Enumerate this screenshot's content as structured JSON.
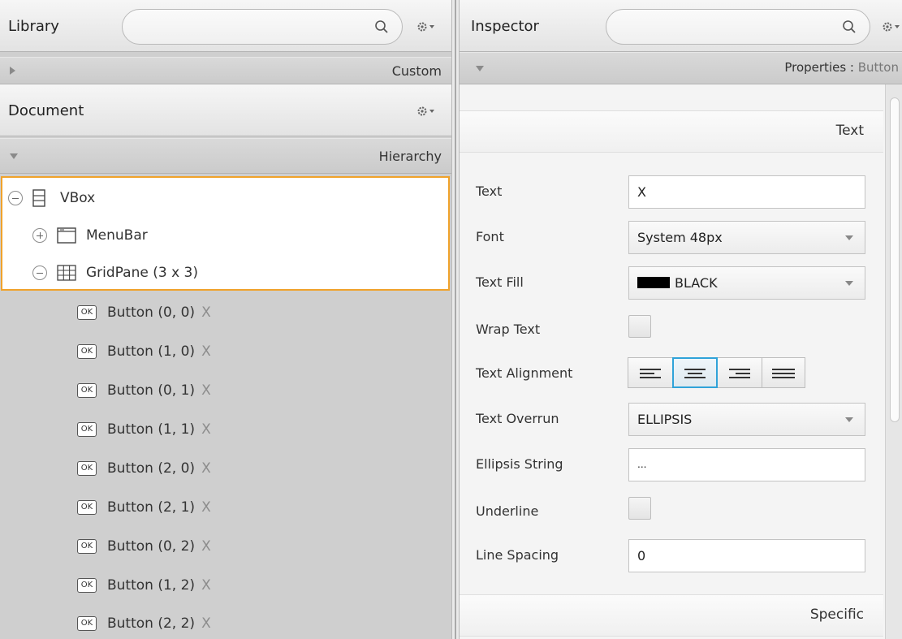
{
  "library": {
    "title": "Library",
    "custom_label": "Custom"
  },
  "document": {
    "title": "Document",
    "hierarchy_label": "Hierarchy",
    "tree": [
      {
        "label": "VBox",
        "expander": "collapse"
      },
      {
        "label": "MenuBar",
        "expander": "expand"
      },
      {
        "label": "GridPane (3 x 3)",
        "expander": "collapse"
      }
    ],
    "buttons": [
      {
        "label": "Button (0, 0)",
        "text": "X"
      },
      {
        "label": "Button (1, 0)",
        "text": "X"
      },
      {
        "label": "Button (0, 1)",
        "text": "X"
      },
      {
        "label": "Button (1, 1)",
        "text": "X"
      },
      {
        "label": "Button (2, 0)",
        "text": "X"
      },
      {
        "label": "Button (2, 1)",
        "text": "X"
      },
      {
        "label": "Button (0, 2)",
        "text": "X"
      },
      {
        "label": "Button (1, 2)",
        "text": "X"
      },
      {
        "label": "Button (2, 2)",
        "text": "X"
      }
    ],
    "button_icon_text": "OK"
  },
  "inspector": {
    "title": "Inspector",
    "properties_prefix": "Properties : ",
    "properties_target": "Button",
    "section_text": "Text",
    "section_specific": "Specific",
    "fields": {
      "text": {
        "label": "Text",
        "value": "X"
      },
      "font": {
        "label": "Font",
        "value": "System 48px"
      },
      "text_fill": {
        "label": "Text Fill",
        "value": "BLACK",
        "color": "#000000"
      },
      "wrap_text": {
        "label": "Wrap Text"
      },
      "text_alignment": {
        "label": "Text Alignment",
        "options": [
          "left",
          "center",
          "right",
          "justify"
        ],
        "selected": "center"
      },
      "text_overrun": {
        "label": "Text Overrun",
        "value": "ELLIPSIS"
      },
      "ellipsis_string": {
        "label": "Ellipsis String",
        "value": "..."
      },
      "underline": {
        "label": "Underline"
      },
      "line_spacing": {
        "label": "Line Spacing",
        "value": "0"
      }
    }
  },
  "colors": {
    "selection_border": "#f0a22b",
    "focus_blue": "#2fa3d9"
  }
}
